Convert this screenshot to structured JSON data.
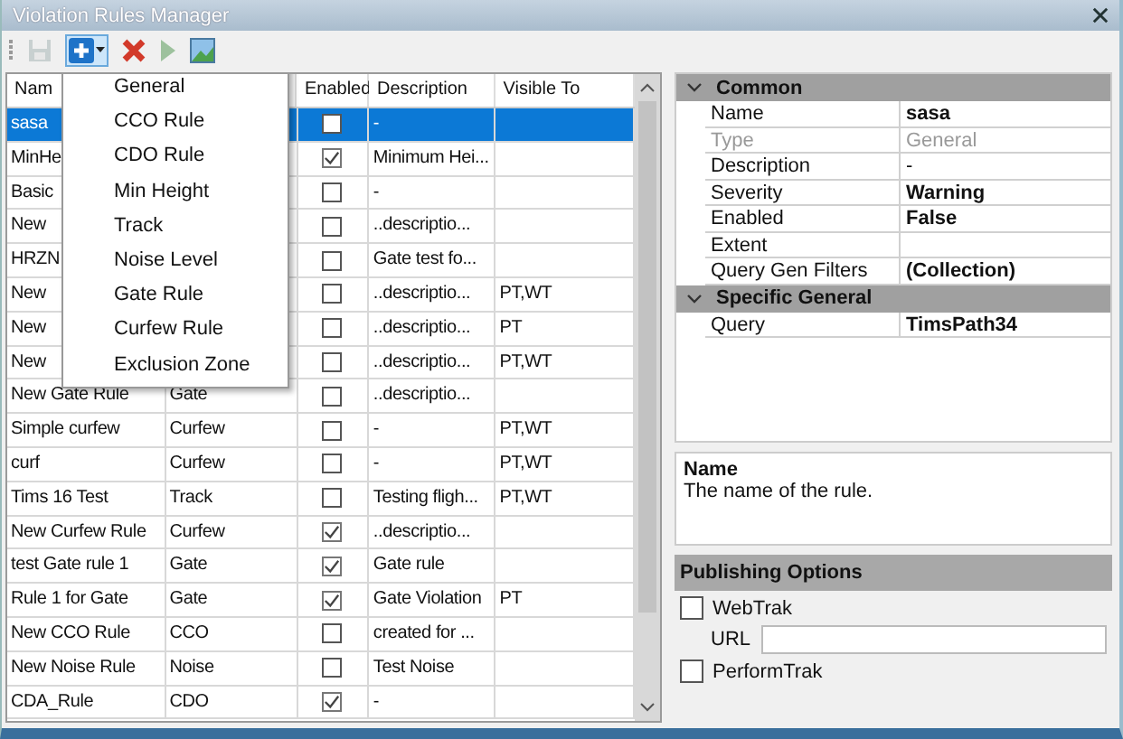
{
  "window": {
    "title": "Violation Rules Manager"
  },
  "toolbar": [
    {
      "kind": "save",
      "disabled": true
    },
    {
      "kind": "add",
      "disabled": false
    },
    {
      "kind": "delete",
      "disabled": false
    },
    {
      "kind": "run",
      "disabled": true
    },
    {
      "kind": "image",
      "disabled": false
    }
  ],
  "table": {
    "columns": [
      "Nam",
      "Enabled",
      "Description",
      "Visible To"
    ],
    "rows": [
      {
        "name": "sasa",
        "type": "",
        "enabled": false,
        "description": "-",
        "visible_to": "",
        "selected": true
      },
      {
        "name": "MinHe",
        "type": "",
        "enabled": true,
        "description": "Minimum Hei...",
        "visible_to": "",
        "selected": false
      },
      {
        "name": "Basic",
        "type": "",
        "enabled": false,
        "description": "-",
        "visible_to": "",
        "selected": false
      },
      {
        "name": "New",
        "type": "",
        "enabled": false,
        "description": "..descriptio...",
        "visible_to": "",
        "selected": false
      },
      {
        "name": "HRZN",
        "type": "",
        "enabled": false,
        "description": "Gate test fo...",
        "visible_to": "",
        "selected": false
      },
      {
        "name": "New",
        "type": "",
        "enabled": false,
        "description": "..descriptio...",
        "visible_to": "PT,WT",
        "selected": false
      },
      {
        "name": "New",
        "type": "",
        "enabled": false,
        "description": "..descriptio...",
        "visible_to": "PT",
        "selected": false
      },
      {
        "name": "New",
        "type": "",
        "enabled": false,
        "description": "..descriptio...",
        "visible_to": "PT,WT",
        "selected": false
      },
      {
        "name": "New Gate Rule",
        "type": "Gate",
        "enabled": false,
        "description": "..descriptio...",
        "visible_to": "",
        "selected": false
      },
      {
        "name": "Simple curfew",
        "type": "Curfew",
        "enabled": false,
        "description": "-",
        "visible_to": "PT,WT",
        "selected": false
      },
      {
        "name": "curf",
        "type": "Curfew",
        "enabled": false,
        "description": "-",
        "visible_to": "PT,WT",
        "selected": false
      },
      {
        "name": "Tims 16 Test",
        "type": "Track",
        "enabled": false,
        "description": "Testing fligh...",
        "visible_to": "PT,WT",
        "selected": false
      },
      {
        "name": "New Curfew Rule",
        "type": "Curfew",
        "enabled": true,
        "description": "..descriptio...",
        "visible_to": "",
        "selected": false
      },
      {
        "name": "test Gate rule 1",
        "type": "Gate",
        "enabled": true,
        "description": "Gate rule",
        "visible_to": "",
        "selected": false
      },
      {
        "name": "Rule 1 for Gate",
        "type": "Gate",
        "enabled": true,
        "description": "Gate Violation",
        "visible_to": "PT",
        "selected": false
      },
      {
        "name": "New CCO Rule",
        "type": "CCO",
        "enabled": false,
        "description": "created for ...",
        "visible_to": "",
        "selected": false
      },
      {
        "name": "New Noise Rule",
        "type": "Noise",
        "enabled": false,
        "description": "Test Noise",
        "visible_to": "",
        "selected": false
      },
      {
        "name": "CDA_Rule",
        "type": "CDO",
        "enabled": true,
        "description": "-",
        "visible_to": "",
        "selected": false
      }
    ]
  },
  "add_menu": {
    "items": [
      "General",
      "CCO Rule",
      "CDO Rule",
      "Min Height",
      "Track",
      "Noise Level",
      "Gate Rule",
      "Curfew Rule",
      "Exclusion Zone"
    ]
  },
  "properties": {
    "categories": [
      {
        "title": "Common",
        "expanded": true,
        "items": [
          {
            "name": "Name",
            "value": "sasa",
            "bold": true,
            "disabled": false
          },
          {
            "name": "Type",
            "value": "General",
            "bold": false,
            "disabled": true
          },
          {
            "name": "Description",
            "value": "-",
            "bold": false,
            "disabled": false
          },
          {
            "name": "Severity",
            "value": "Warning",
            "bold": true,
            "disabled": false
          },
          {
            "name": "Enabled",
            "value": "False",
            "bold": true,
            "disabled": false
          },
          {
            "name": "Extent",
            "value": "",
            "bold": false,
            "disabled": false
          },
          {
            "name": "Query Gen Filters",
            "value": "(Collection)",
            "bold": true,
            "disabled": false
          }
        ]
      },
      {
        "title": "Specific General",
        "expanded": true,
        "items": [
          {
            "name": "Query",
            "value": "TimsPath34",
            "bold": true,
            "disabled": false
          }
        ]
      }
    ]
  },
  "help": {
    "title": "Name",
    "text": "The name of the rule."
  },
  "publishing": {
    "title": "Publishing Options",
    "webtrak": {
      "label": "WebTrak",
      "checked": false
    },
    "url_label": "URL",
    "performtrak": {
      "label": "PerformTrak",
      "checked": false
    }
  }
}
